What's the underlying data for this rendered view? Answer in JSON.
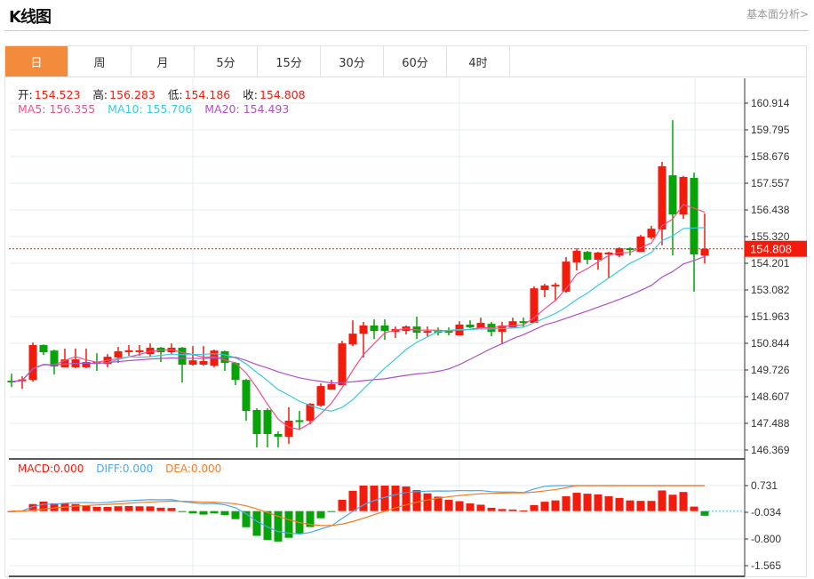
{
  "header": {
    "title": "K线图",
    "link": "基本面分析>"
  },
  "tabs": [
    {
      "label": "日",
      "active": true
    },
    {
      "label": "周"
    },
    {
      "label": "月"
    },
    {
      "label": "5分"
    },
    {
      "label": "15分"
    },
    {
      "label": "30分"
    },
    {
      "label": "60分"
    },
    {
      "label": "4时"
    }
  ],
  "ohlc_legend": {
    "open_label": "开:",
    "open": "154.523",
    "high_label": "高:",
    "high": "156.283",
    "low_label": "低:",
    "low": "154.186",
    "close_label": "收:",
    "close": "154.808"
  },
  "ma_legend": {
    "ma5": "MA5: 156.355",
    "ma10": "MA10: 155.706",
    "ma20": "MA20: 154.493"
  },
  "macd_legend": {
    "macd": "MACD:0.000",
    "diff": "DIFF:0.000",
    "dea": "DEA:0.000"
  },
  "colors": {
    "up": "#f21b0c",
    "down": "#08a308",
    "ma5": "#f0508a",
    "ma10": "#3cc8e0",
    "ma20": "#b050c8",
    "diff": "#4aa8f0",
    "dea": "#f57c1f",
    "accent": "#f28c3c"
  },
  "chart_data": {
    "type": "candlestick",
    "price_axis_ticks": [
      "160.914",
      "159.795",
      "158.676",
      "157.557",
      "156.438",
      "155.320",
      "154.201",
      "153.082",
      "151.963",
      "150.844",
      "149.726",
      "148.607",
      "147.488",
      "146.369"
    ],
    "price_range": [
      146.369,
      160.914
    ],
    "current_price": "154.808",
    "macd_axis_ticks": [
      "0.731",
      "-0.034",
      "-0.800",
      "-1.565"
    ],
    "macd_range": [
      -1.565,
      0.731
    ],
    "ohlc": [
      [
        149.28,
        149.57,
        149.01,
        149.24
      ],
      [
        149.31,
        149.46,
        148.94,
        149.33
      ],
      [
        149.31,
        150.88,
        149.24,
        150.77
      ],
      [
        150.77,
        150.8,
        150.36,
        150.47
      ],
      [
        150.54,
        150.58,
        149.54,
        149.87
      ],
      [
        149.84,
        150.62,
        149.84,
        150.17
      ],
      [
        149.84,
        150.62,
        149.8,
        150.17
      ],
      [
        149.84,
        150.62,
        149.8,
        150.06
      ],
      [
        150.06,
        150.43,
        149.69,
        149.98
      ],
      [
        149.98,
        150.39,
        149.84,
        150.28
      ],
      [
        150.25,
        150.69,
        150.02,
        150.51
      ],
      [
        150.53,
        150.77,
        150.32,
        150.55
      ],
      [
        150.53,
        150.77,
        150.32,
        150.55
      ],
      [
        150.39,
        150.84,
        150.28,
        150.66
      ],
      [
        150.66,
        150.69,
        150.06,
        150.47
      ],
      [
        150.47,
        150.84,
        150.39,
        150.66
      ],
      [
        150.66,
        150.69,
        149.2,
        149.95
      ],
      [
        149.95,
        150.73,
        149.91,
        150.13
      ],
      [
        149.95,
        150.73,
        149.91,
        150.1
      ],
      [
        149.91,
        150.58,
        149.84,
        150.54
      ],
      [
        150.51,
        150.54,
        149.69,
        150.02
      ],
      [
        150.02,
        150.06,
        149.09,
        149.31
      ],
      [
        149.31,
        149.35,
        147.6,
        148.01
      ],
      [
        148.05,
        148.12,
        146.48,
        147.04
      ],
      [
        148.05,
        148.12,
        146.48,
        147.04
      ],
      [
        147.04,
        147.15,
        146.48,
        146.93
      ],
      [
        146.93,
        148.16,
        146.63,
        147.6
      ],
      [
        147.62,
        148.01,
        147.22,
        147.58
      ],
      [
        147.6,
        148.34,
        147.45,
        148.31
      ],
      [
        148.23,
        149.16,
        148.19,
        149.05
      ],
      [
        148.9,
        149.31,
        148.9,
        149.13
      ],
      [
        149.09,
        150.95,
        149.09,
        150.84
      ],
      [
        150.8,
        151.81,
        150.73,
        151.25
      ],
      [
        151.25,
        151.74,
        150.25,
        151.59
      ],
      [
        151.59,
        151.85,
        151.03,
        151.36
      ],
      [
        151.59,
        151.85,
        150.99,
        151.36
      ],
      [
        151.33,
        151.55,
        151.07,
        151.44
      ],
      [
        151.36,
        151.59,
        151.22,
        151.55
      ],
      [
        151.55,
        151.96,
        151.03,
        151.29
      ],
      [
        151.29,
        151.55,
        151.14,
        151.36
      ],
      [
        151.36,
        151.51,
        151.18,
        151.33
      ],
      [
        151.36,
        151.51,
        151.18,
        151.33
      ],
      [
        151.18,
        151.77,
        151.18,
        151.63
      ],
      [
        151.63,
        151.81,
        151.48,
        151.51
      ],
      [
        151.48,
        151.92,
        151.44,
        151.7
      ],
      [
        151.66,
        151.74,
        151.14,
        151.33
      ],
      [
        151.33,
        151.74,
        150.84,
        151.59
      ],
      [
        151.51,
        151.92,
        151.51,
        151.77
      ],
      [
        151.77,
        151.92,
        151.51,
        151.7
      ],
      [
        151.7,
        153.23,
        151.7,
        153.15
      ],
      [
        153.08,
        153.34,
        152.78,
        153.27
      ],
      [
        153.23,
        153.38,
        152.63,
        153.3
      ],
      [
        153.01,
        154.46,
        152.97,
        154.27
      ],
      [
        154.24,
        154.83,
        153.9,
        154.72
      ],
      [
        154.68,
        154.72,
        154.16,
        154.35
      ],
      [
        154.35,
        154.68,
        153.94,
        154.65
      ],
      [
        154.61,
        154.68,
        153.57,
        154.65
      ],
      [
        154.53,
        154.87,
        154.46,
        154.83
      ],
      [
        154.83,
        154.87,
        154.53,
        154.8
      ],
      [
        154.68,
        155.39,
        154.68,
        155.32
      ],
      [
        155.28,
        155.77,
        155.21,
        155.65
      ],
      [
        155.62,
        158.45,
        154.95,
        158.27
      ],
      [
        157.89,
        160.2,
        154.53,
        156.25
      ],
      [
        156.25,
        157.86,
        156.06,
        157.82
      ],
      [
        157.78,
        158.0,
        153.01,
        154.57
      ],
      [
        154.523,
        156.283,
        154.186,
        154.808
      ]
    ],
    "ma_periods": [
      5,
      10,
      20
    ],
    "macd_params": [
      12,
      26,
      9
    ]
  }
}
